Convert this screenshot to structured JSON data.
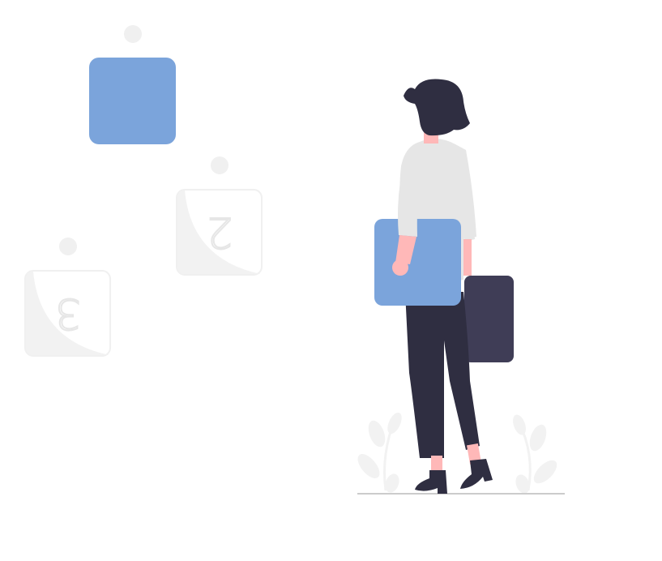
{
  "illustration": {
    "card_1": {
      "label": "",
      "color": "#7ba4db"
    },
    "card_2": {
      "label": "2",
      "color": "#f2f2f2"
    },
    "card_3": {
      "label": "3",
      "color": "#f2f2f2"
    },
    "held_card": {
      "color": "#7ba4db"
    },
    "briefcase": {
      "color": "#3f3d56"
    },
    "colors": {
      "accent_blue": "#7ba4db",
      "dark_navy": "#2f2e41",
      "skin": "#ffb8b8",
      "shirt": "#e6e6e6",
      "muted_gray": "#f2f2f2",
      "ground_line": "#cccccc"
    }
  }
}
